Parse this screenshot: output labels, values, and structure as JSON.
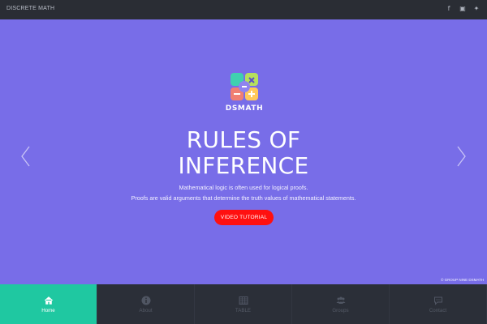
{
  "header": {
    "brand": "DISCRETE MATH",
    "social_icons": [
      "facebook-icon",
      "youtube-icon",
      "twitter-icon"
    ]
  },
  "hero": {
    "logo_text": "DSMATH",
    "title_line1": "RULES OF",
    "title_line2": "INFERENCE",
    "description_line1": "Mathematical logic is often used for logical proofs.",
    "description_line2": "Proofs are valid arguments that determine the truth values of mathematical statements.",
    "cta_label": "VIDEO TUTORIAL",
    "copyright": "© GROUP NINE DSMATH",
    "background_color": "#786de8",
    "cta_color": "#ff1010"
  },
  "nav": {
    "items": [
      {
        "label": "Home",
        "icon": "home-icon"
      },
      {
        "label": "About",
        "icon": "info-icon"
      },
      {
        "label": "TABLE",
        "icon": "table-icon"
      },
      {
        "label": "Groups",
        "icon": "users-icon"
      },
      {
        "label": "Contact",
        "icon": "chat-icon"
      }
    ],
    "active_index": 0,
    "active_color": "#1fc8a1"
  }
}
